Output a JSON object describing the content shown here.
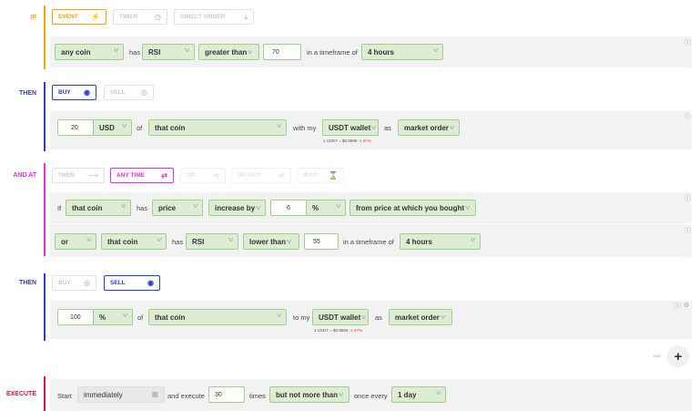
{
  "colors": {
    "if": "#f0a500",
    "then": "#2b3ed1",
    "and_at": "#e32ee0",
    "execute": "#e0104a",
    "field_bg": "#dcedd3",
    "field_border": "#9fd08b"
  },
  "if_section": {
    "label": "IF",
    "tabs": {
      "event": "EVENT",
      "timer": "TIMER",
      "direct_order": "DIRECT ORDER"
    },
    "row": {
      "coin": "any coin",
      "has": "has",
      "indicator": "RSI",
      "comparison": "greater than",
      "value": "70",
      "timeframe_text": "in a timeframe of",
      "timeframe": "4 hours"
    }
  },
  "then_buy": {
    "label": "THEN",
    "tabs": {
      "buy": "BUY",
      "sell": "SELL"
    },
    "row": {
      "amount": "20",
      "currency": "USD",
      "of": "of",
      "coin": "that coin",
      "with_my": "with my",
      "wallet": "USDT wallet",
      "as": "as",
      "order_type": "market order",
      "rate_prefix": "1 USDT = $0.9895",
      "rate_change": "-1.97%"
    }
  },
  "and_at": {
    "label": "AND AT",
    "tabs": {
      "then": "THEN",
      "any_time": "ANY TIME",
      "or": "OR",
      "do_not": "DO NOT",
      "wait": "WAIT"
    },
    "row1": {
      "if": "If",
      "coin": "that coin",
      "has": "has",
      "metric": "price",
      "direction": "increase by",
      "value": "6",
      "unit": "%",
      "reference": "from price at which you bought"
    },
    "row2": {
      "connector": "or",
      "coin": "that coin",
      "has": "has",
      "indicator": "RSI",
      "comparison": "lower than",
      "value": "55",
      "timeframe_text": "in a timeframe of",
      "timeframe": "4 hours"
    }
  },
  "then_sell": {
    "label": "THEN",
    "tabs": {
      "buy": "BUY",
      "sell": "SELL"
    },
    "row": {
      "amount": "100",
      "unit": "%",
      "of": "of",
      "coin": "that coin",
      "to_my": "to my",
      "wallet": "USDT wallet",
      "as": "as",
      "order_type": "market order",
      "rate_prefix": "1 USDT = $0.9895",
      "rate_change": "-1.97%"
    },
    "add_label": "ADD",
    "add_symbol": "+"
  },
  "execute": {
    "label": "EXECUTE",
    "row": {
      "start": "Start",
      "when": "immediately",
      "and_execute": "and execute",
      "times_value": "30",
      "times": "times",
      "limit": "but not more than",
      "once_every": "once every",
      "interval": "1 day"
    }
  }
}
